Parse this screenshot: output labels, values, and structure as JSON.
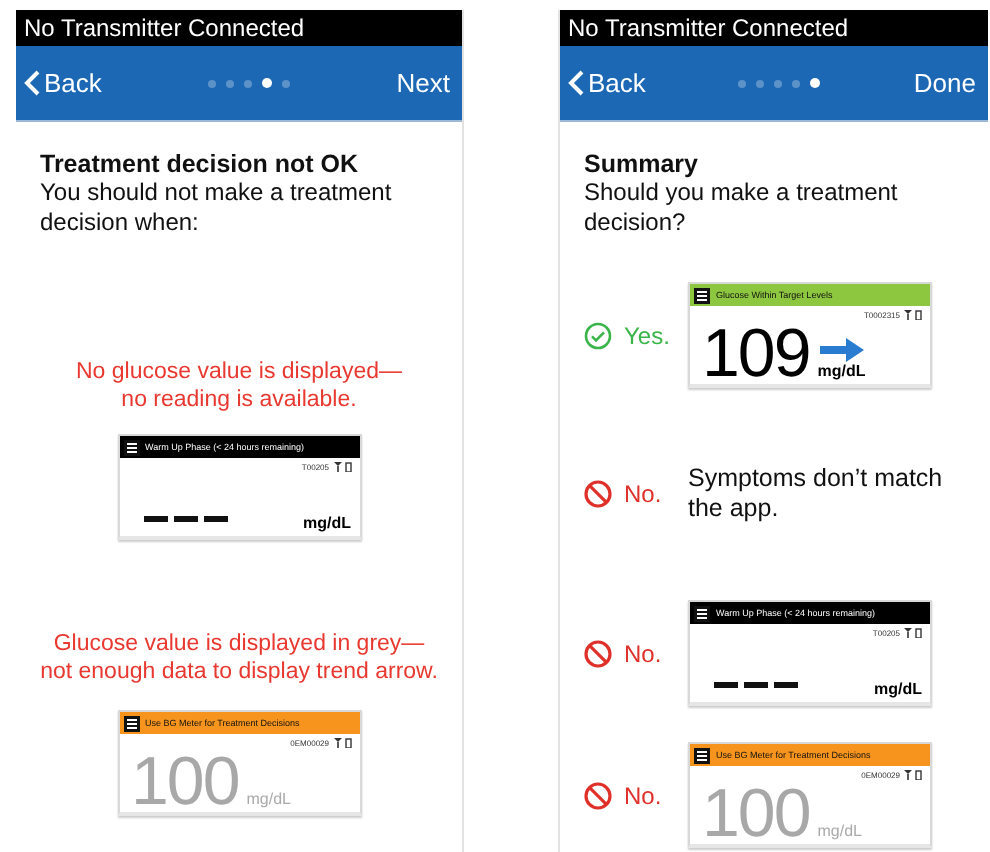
{
  "panels": [
    {
      "status": "No Transmitter Connected",
      "nav": {
        "back": "Back",
        "action": "Next",
        "dots": [
          {
            "selected": false
          },
          {
            "selected": false
          },
          {
            "selected": false
          },
          {
            "selected": true
          },
          {
            "selected": false
          }
        ]
      },
      "title": "Treatment decision not OK",
      "subtitle": "You should not make a treatment decision when:",
      "items": [
        {
          "kind": "caption",
          "text": "No glucose value is displayed—\nno reading is available."
        },
        {
          "kind": "device",
          "device": {
            "kind": "no-reading",
            "color": "#000000",
            "header": "Warm Up Phase (< 24 hours remaining)",
            "serial": "T00205",
            "unit": "mg/dL"
          }
        },
        {
          "kind": "caption",
          "text": "Glucose value is displayed in grey—\nnot enough data to display trend arrow."
        },
        {
          "kind": "device",
          "device": {
            "kind": "reading",
            "color": "#f7941d",
            "header": "Use BG Meter for Treatment Decisions",
            "serial": "0EM00029",
            "value": "100",
            "unit": "mg/dL",
            "grey": true,
            "trend": false
          }
        }
      ]
    },
    {
      "status": "No Transmitter Connected",
      "nav": {
        "back": "Back",
        "action": "Done",
        "dots": [
          {
            "selected": false
          },
          {
            "selected": false
          },
          {
            "selected": false
          },
          {
            "selected": false
          },
          {
            "selected": true
          }
        ]
      },
      "title": "Summary",
      "subtitle": "Should you make a treatment decision?",
      "items": [
        {
          "kind": "verdict",
          "verdict": {
            "kind": "yes",
            "label": "Yes."
          },
          "device": {
            "kind": "reading",
            "color": "#8dc63f",
            "header": "Glucose Within Target Levels",
            "serial": "T0002315",
            "value": "109",
            "unit": "mg/dL",
            "grey": false,
            "trend": true
          }
        },
        {
          "kind": "verdict",
          "verdict": {
            "kind": "no",
            "label": "No."
          },
          "text": "Symptoms don’t match the app."
        },
        {
          "kind": "verdict",
          "verdict": {
            "kind": "no",
            "label": "No."
          },
          "device": {
            "kind": "no-reading",
            "color": "#000000",
            "header": "Warm Up Phase (< 24 hours remaining)",
            "serial": "T00205",
            "unit": "mg/dL"
          }
        },
        {
          "kind": "verdict",
          "verdict": {
            "kind": "no",
            "label": "No."
          },
          "device": {
            "kind": "reading",
            "color": "#f7941d",
            "header": "Use BG Meter for Treatment Decisions",
            "serial": "0EM00029",
            "value": "100",
            "unit": "mg/dL",
            "grey": true,
            "trend": false
          }
        }
      ]
    }
  ]
}
